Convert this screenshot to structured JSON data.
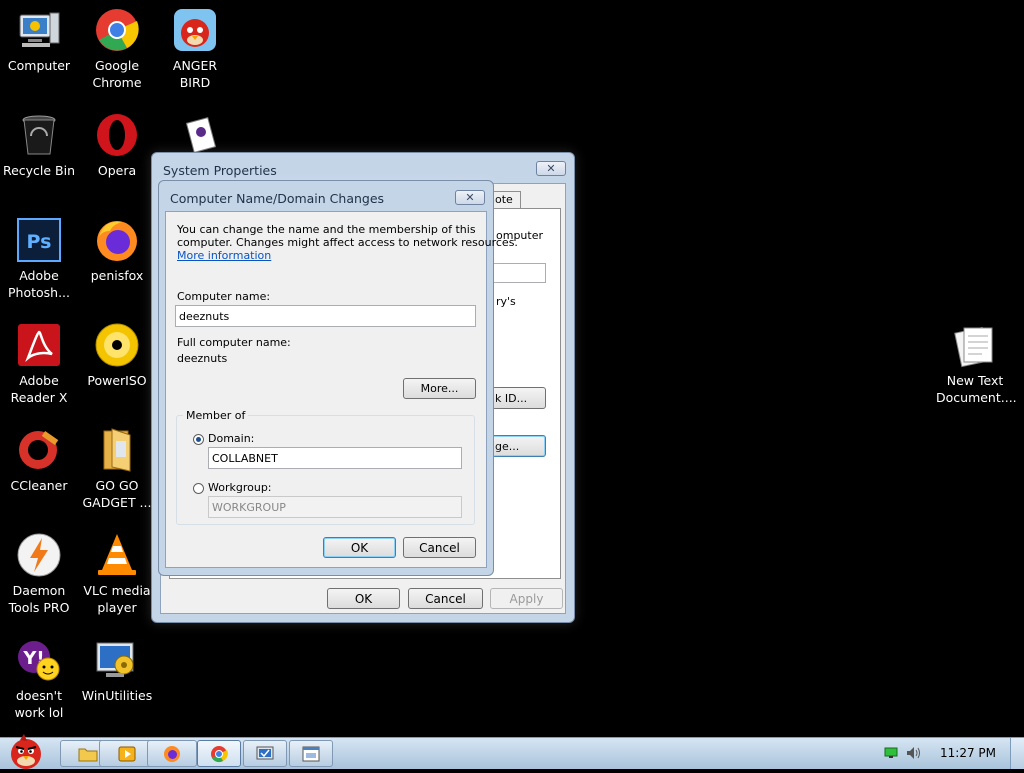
{
  "desktop": {
    "icons": [
      {
        "label": "Computer"
      },
      {
        "label": "Google Chrome"
      },
      {
        "label": "ANGER BIRD"
      },
      {
        "label": "Recycle Bin"
      },
      {
        "label": "Opera"
      },
      {
        "label": "Adobe Photosh..."
      },
      {
        "label": "penisfox"
      },
      {
        "label": "Adobe Reader X"
      },
      {
        "label": "PowerISO"
      },
      {
        "label": "CCleaner"
      },
      {
        "label": "GO GO GADGET ..."
      },
      {
        "label": "Daemon Tools PRO"
      },
      {
        "label": "VLC media player"
      },
      {
        "label": "doesn't work lol"
      },
      {
        "label": "WinUtilities"
      },
      {
        "label": "New Text Document...."
      }
    ]
  },
  "system_properties": {
    "title": "System Properties",
    "tab_fragment": "note",
    "frag_computer": "omputer",
    "frag_ys": "ry's",
    "frag_id_button": "k ID...",
    "frag_change_button": "ge...",
    "ok": "OK",
    "cancel": "Cancel",
    "apply": "Apply"
  },
  "dialog": {
    "title": "Computer Name/Domain Changes",
    "intro_line1": "You can change the name and the membership of this",
    "intro_line2": "computer. Changes might affect access to network resources.",
    "more_info_link": "More information",
    "computer_name_label": "Computer name:",
    "computer_name_value": "deeznuts",
    "full_name_label": "Full computer name:",
    "full_name_value": "deeznuts",
    "more_button": "More...",
    "member_of_label": "Member of",
    "domain_label": "Domain:",
    "domain_value": "COLLABNET",
    "workgroup_label": "Workgroup:",
    "workgroup_value": "WORKGROUP",
    "selected": "domain",
    "ok": "OK",
    "cancel": "Cancel"
  },
  "taskbar": {
    "clock": "11:27 PM"
  }
}
